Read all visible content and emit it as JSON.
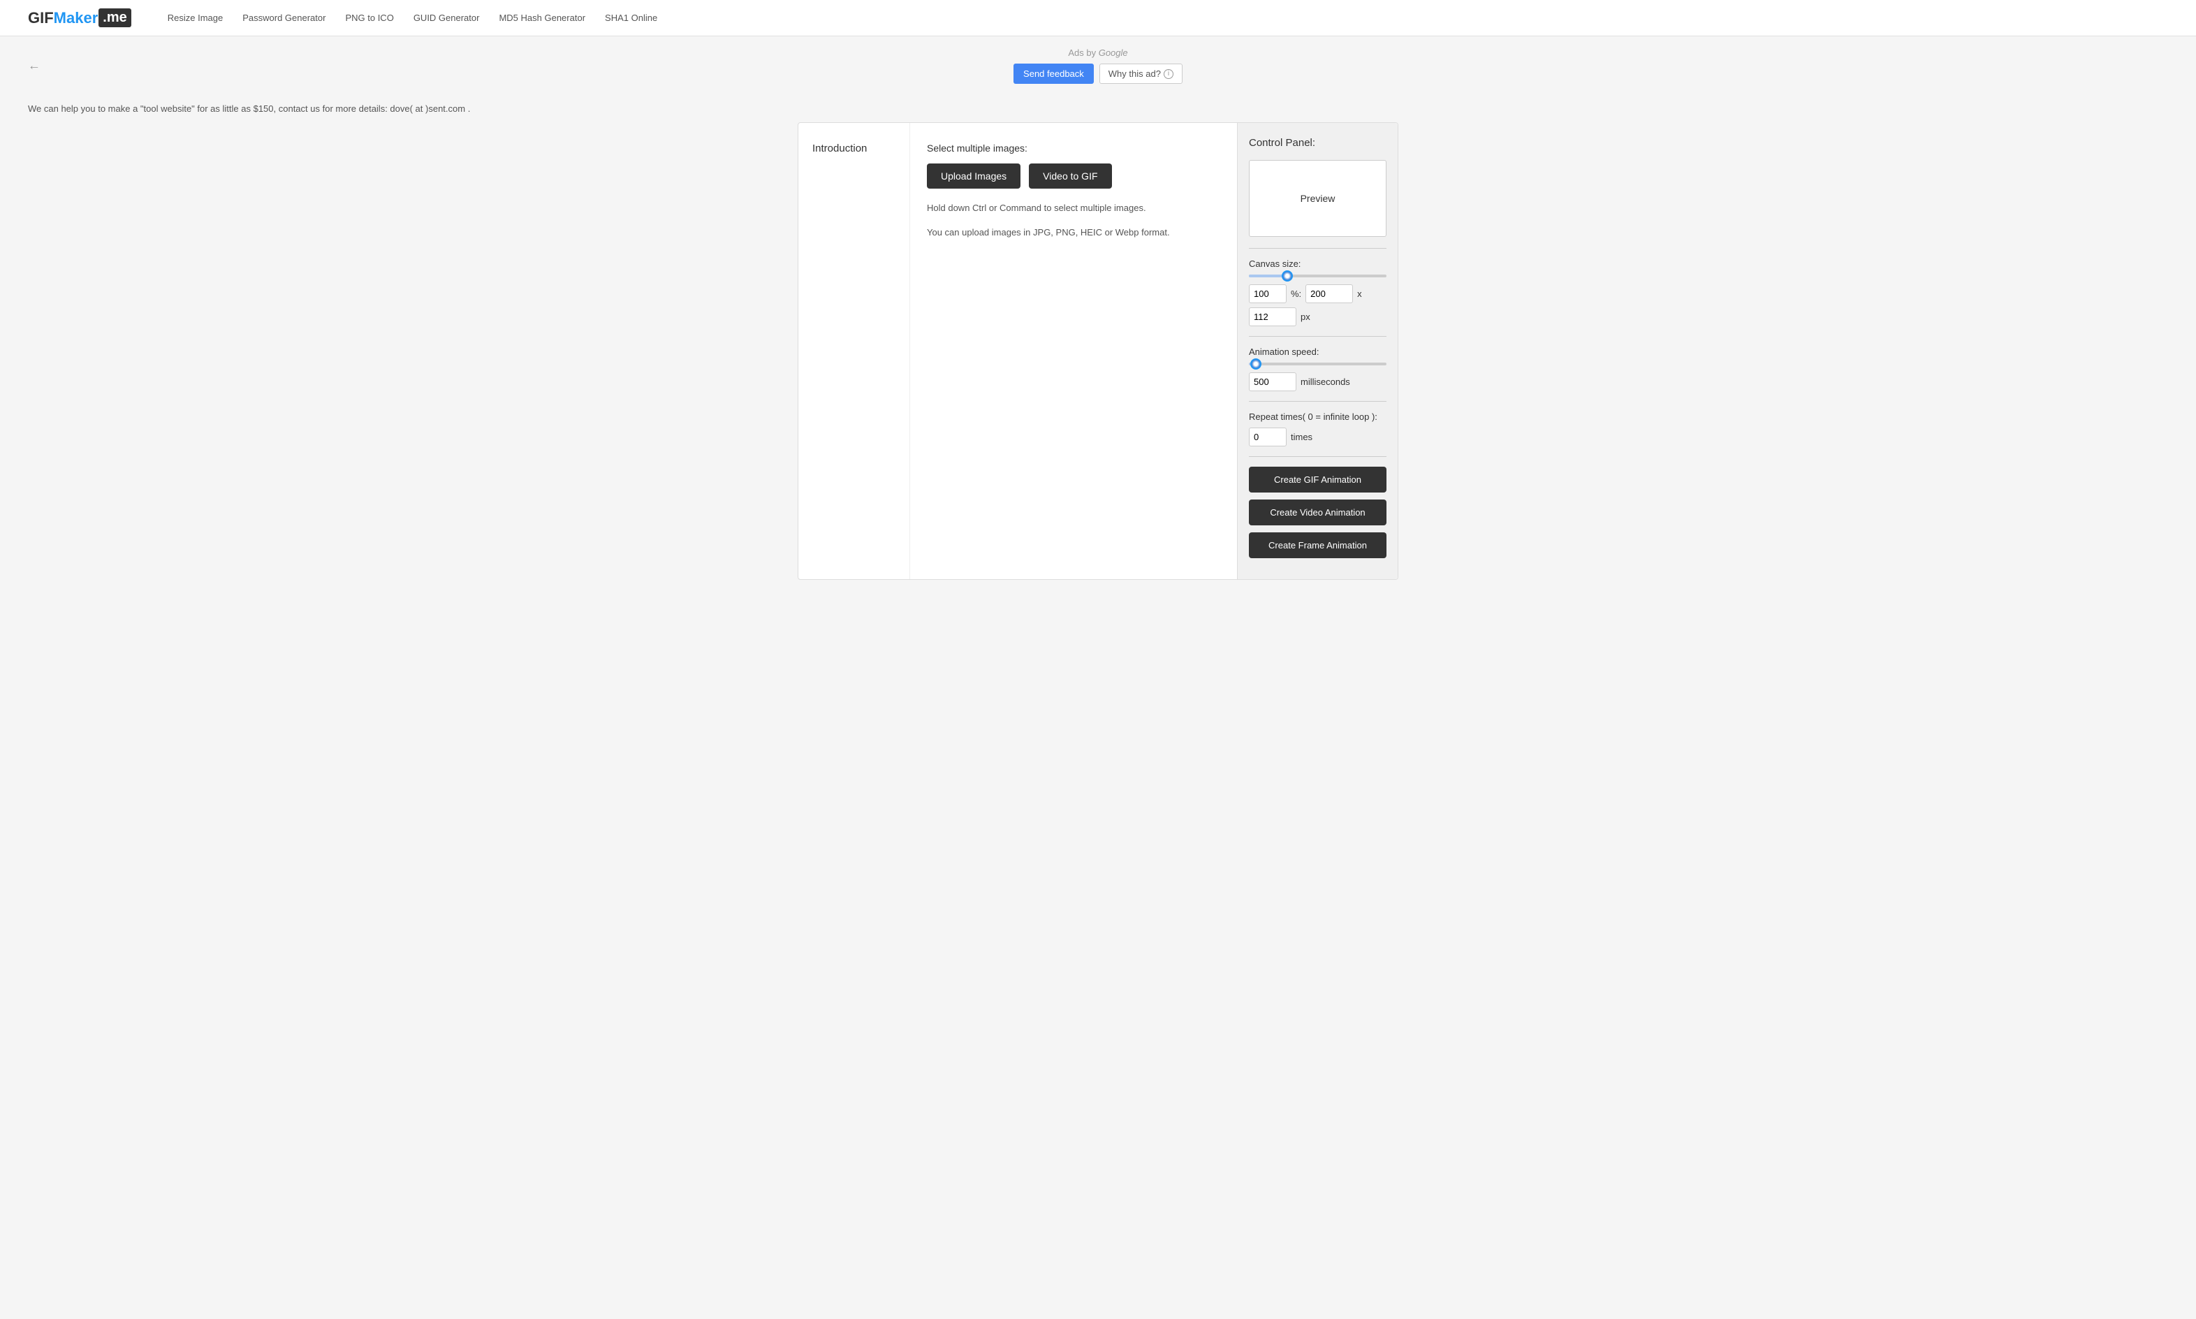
{
  "header": {
    "logo": {
      "gif": "GIF",
      "maker": "Maker",
      "me": ".me"
    },
    "nav": [
      {
        "label": "Resize Image",
        "href": "#"
      },
      {
        "label": "Password Generator",
        "href": "#"
      },
      {
        "label": "PNG to ICO",
        "href": "#"
      },
      {
        "label": "GUID Generator",
        "href": "#"
      },
      {
        "label": "MD5 Hash Generator",
        "href": "#"
      },
      {
        "label": "SHA1 Online",
        "href": "#"
      }
    ]
  },
  "ad_bar": {
    "back_arrow": "←",
    "ads_by": "Ads by",
    "google": "Google",
    "send_feedback": "Send feedback",
    "why_this_ad": "Why this ad?",
    "info_icon": "i"
  },
  "promo": {
    "text": "We can help you to make a \"tool website\" for as little as $150, contact us for more details: dove( at )sent.com ."
  },
  "main": {
    "intro": {
      "title": "Introduction"
    },
    "center": {
      "select_label": "Select multiple images:",
      "upload_images": "Upload Images",
      "video_to_gif": "Video to GIF",
      "info1": "Hold down Ctrl or Command to select multiple images.",
      "info2": "You can upload images in JPG, PNG, HEIC or Webp format."
    },
    "control_panel": {
      "title": "Control Panel:",
      "preview_text": "Preview",
      "canvas_size_label": "Canvas size:",
      "canvas_percent_value": "100",
      "canvas_percent_unit": "%:",
      "canvas_width_value": "200",
      "canvas_height_value": "112",
      "canvas_px": "px",
      "canvas_x": "x",
      "animation_speed_label": "Animation speed:",
      "animation_speed_value": "500",
      "animation_speed_unit": "milliseconds",
      "repeat_label": "Repeat times( 0 = infinite loop ):",
      "repeat_value": "0",
      "repeat_unit": "times",
      "create_gif": "Create GIF Animation",
      "create_video": "Create Video Animation",
      "create_frame": "Create Frame Animation",
      "canvas_slider_percent": 28,
      "animation_slider_percent": 5
    }
  }
}
